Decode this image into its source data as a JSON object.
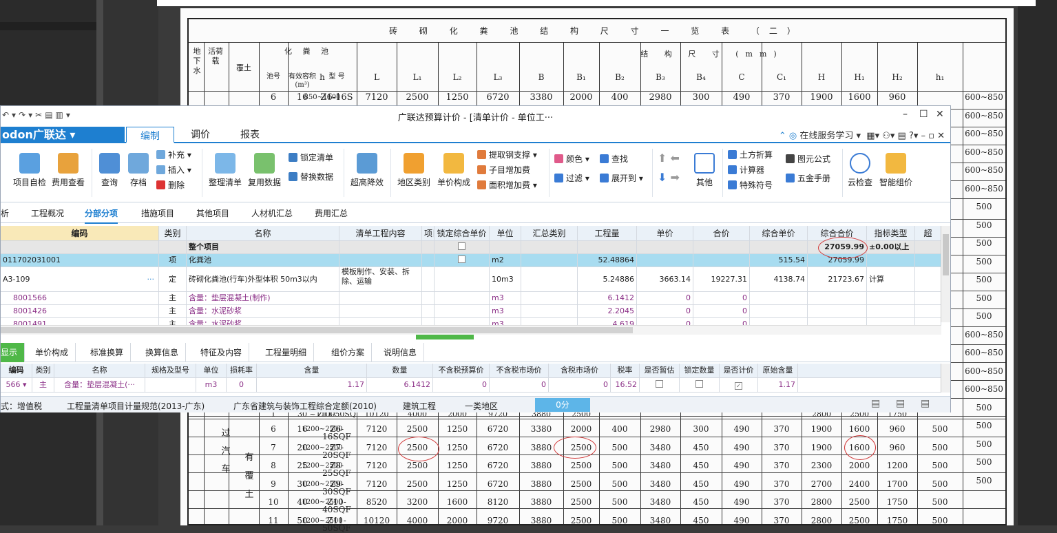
{
  "background": {
    "drawing_title": "砖 砌 化 粪 池 结 构 尺 寸 一 览 表 （二）",
    "header_groups": {
      "col1": "地下水",
      "col2": "活荷载",
      "col3": "覆土",
      "septic_tank": "化 粪 池",
      "dimension_title": "结 构 尺 寸 (mm)"
    },
    "header_cols": [
      "池号",
      "有效容积(m³)",
      "型 号",
      "h",
      "L",
      "L₁",
      "L₂",
      "L₃",
      "B",
      "B₁",
      "B₂",
      "B₃",
      "B₄",
      "C",
      "C₁",
      "H",
      "H₁",
      "H₂",
      "h₁"
    ],
    "right_col": [
      "600~850",
      "600~850",
      "600~850",
      "600~850",
      "600~850",
      "600~850",
      "500",
      "500",
      "500",
      "500",
      "500",
      "500",
      "500",
      "600~850",
      "600~850",
      "600~850",
      "600~850",
      "500",
      "500",
      "500",
      "500",
      "500"
    ],
    "side_labels": [
      "过",
      "汽",
      "车",
      "有",
      "覆",
      "土"
    ],
    "first_row": [
      "6",
      "16",
      "Z6-16S",
      "850~1100",
      "7120",
      "2500",
      "1250",
      "6720",
      "3380",
      "2000",
      "400",
      "2980",
      "300",
      "490",
      "370",
      "1900",
      "1600",
      "960"
    ],
    "bottom_rows": [
      [
        "6",
        "16",
        "Z6-16SQF",
        "1200~2500",
        "7120",
        "2500",
        "1250",
        "6720",
        "3380",
        "2000",
        "400",
        "2980",
        "300",
        "490",
        "370",
        "1900",
        "1600",
        "960",
        "500"
      ],
      [
        "7",
        "20",
        "Z7-20SQF",
        "1200~2500",
        "7120",
        "2500",
        "1250",
        "6720",
        "3880",
        "2500",
        "500",
        "3480",
        "450",
        "490",
        "370",
        "1900",
        "1600",
        "960",
        "500"
      ],
      [
        "8",
        "25",
        "Z8-25SQF",
        "1200~2500",
        "7120",
        "2500",
        "1250",
        "6720",
        "3880",
        "2500",
        "500",
        "3480",
        "450",
        "490",
        "370",
        "2300",
        "2000",
        "1200",
        "500"
      ],
      [
        "9",
        "30",
        "Z9-30SQF",
        "1200~2500",
        "7120",
        "2500",
        "1250",
        "6720",
        "3880",
        "2500",
        "500",
        "3480",
        "450",
        "490",
        "370",
        "2700",
        "2400",
        "1700",
        "500"
      ],
      [
        "10",
        "40",
        "Z10-40SQF",
        "1200~2500",
        "8520",
        "3200",
        "1600",
        "8120",
        "3880",
        "2500",
        "500",
        "3480",
        "450",
        "490",
        "370",
        "2800",
        "2500",
        "1750",
        "500"
      ],
      [
        "11",
        "50",
        "Z11-50SQF",
        "1200~2500",
        "10120",
        "4000",
        "2000",
        "9720",
        "3880",
        "2500",
        "500",
        "3480",
        "450",
        "490",
        "370",
        "2800",
        "2500",
        "1750",
        "500"
      ]
    ],
    "partial_row": [
      "1",
      "30",
      "Z11-50SQ",
      "~1100",
      "10120",
      "4000",
      "2000",
      "9720",
      "3880",
      "2500",
      "",
      "",
      "",
      "",
      "",
      "2800",
      "2500",
      "1750"
    ]
  },
  "app": {
    "title": "广联达预算计价 - [清单计价 - 单位工···",
    "logo": "odon广联达 ▾",
    "menus": [
      "编制",
      "调价",
      "报表"
    ],
    "online_help": "在线服务学习",
    "ribbon": {
      "project_check": "项目自检",
      "fee_view": "费用查看",
      "query": "查询",
      "save": "存档",
      "supplement": "补充",
      "insert": "插入",
      "delete": "删除",
      "organize": "整理清单",
      "reuse": "复用数据",
      "lock": "锁定清单",
      "replace": "替换数据",
      "super_drop": "超高降效",
      "region": "地区类别",
      "unit_price": "单价构成",
      "steel": "提取钢支撑",
      "sub_fee": "子目增加费",
      "area_fee": "面积增加费",
      "color": "颜色",
      "find": "查找",
      "filter": "过滤",
      "expand": "展开到",
      "other": "其他",
      "earth": "土方折算",
      "calc": "计算器",
      "special": "特殊符号",
      "formula": "图元公式",
      "hardware": "五金手册",
      "cloud": "云检查",
      "smart": "智能组价"
    },
    "tabs": [
      "析",
      "工程概况",
      "分部分项",
      "措施项目",
      "其他项目",
      "人材机汇总",
      "费用汇总"
    ],
    "grid_headers": [
      "编码",
      "类别",
      "名称",
      "清单工程内容",
      "项目",
      "锁定综合单价",
      "单位",
      "汇总类别",
      "工程量",
      "单价",
      "合价",
      "综合单价",
      "综合合价",
      "指标类型",
      "超"
    ],
    "rows": [
      {
        "code": "",
        "type": "",
        "name": "整个项目",
        "content": "",
        "unit": "",
        "qty": "",
        "price": "",
        "total": "",
        "cprice": "",
        "ctotal": "27059.99",
        "idx": "±0.00以上"
      },
      {
        "code": "011702031001",
        "type": "项",
        "name": "化粪池",
        "content": "",
        "unit": "m2",
        "qty": "52.48864",
        "price": "",
        "total": "",
        "cprice": "515.54",
        "ctotal": "27059.99",
        "idx": ""
      },
      {
        "code": "A3-109",
        "type": "定",
        "name": "砖砌化粪池(行车)外型体积 50m3以内",
        "content": "模板制作、安装、拆除、运输",
        "unit": "10m3",
        "qty": "5.24886",
        "price": "3663.14",
        "total": "19227.31",
        "cprice": "4138.74",
        "ctotal": "21723.67",
        "idx": "计算"
      },
      {
        "code": "8001566",
        "type": "主",
        "name": "含量：垫层混凝土(制作)",
        "content": "",
        "unit": "m3",
        "qty": "6.1412",
        "price": "0",
        "total": "0",
        "cprice": "",
        "ctotal": "",
        "idx": ""
      },
      {
        "code": "8001426",
        "type": "主",
        "name": "含量：水泥砂浆",
        "content": "",
        "unit": "m3",
        "qty": "2.2045",
        "price": "0",
        "total": "0",
        "cprice": "",
        "ctotal": "",
        "idx": ""
      },
      {
        "code": "8001491",
        "type": "主",
        "name": "含量：水泥砂浆",
        "content": "",
        "unit": "m3",
        "qty": "4.619",
        "price": "0",
        "total": "0",
        "cprice": "",
        "ctotal": "",
        "idx": ""
      }
    ],
    "bottom_tabs": [
      "显示",
      "单价构成",
      "标准换算",
      "换算信息",
      "特征及内容",
      "工程量明细",
      "组价方案",
      "说明信息"
    ],
    "sub_headers": [
      "编码",
      "类别",
      "名称",
      "规格及型号",
      "单位",
      "损耗率",
      "含量",
      "数量",
      "不含税预算价",
      "不含税市场价",
      "含税市场价",
      "税率",
      "是否暂估",
      "锁定数量",
      "是否计价",
      "原始含量"
    ],
    "sub_row": {
      "code": "566",
      "type": "主",
      "name": "含量：垫层混凝土(···",
      "unit": "m3",
      "loss": "0",
      "content": "1.17",
      "qty": "6.1412",
      "p1": "0",
      "p2": "0",
      "p3": "0",
      "tax": "16.52",
      "orig": "1.17"
    },
    "status": [
      "式：增值税",
      "工程量清单项目计量规范(2013-广东)",
      "广东省建筑与装饰工程综合定额(2010)",
      "建筑工程",
      "一类地区",
      "0分"
    ],
    "colors": {
      "accent": "#1e7fd0",
      "green": "#4fb848",
      "selected_row": "#a8dcf0"
    }
  }
}
